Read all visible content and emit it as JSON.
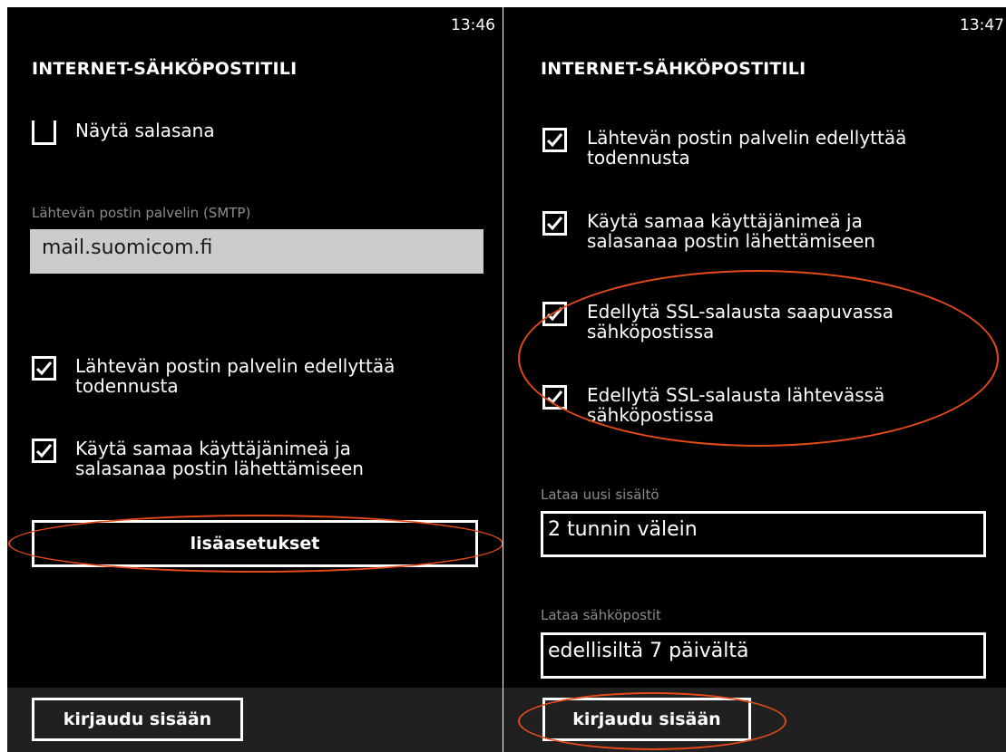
{
  "accent_colors": {
    "background": "#000000",
    "annotation": "#e64a19",
    "field_fill": "#cccccc",
    "appbar": "#202020"
  },
  "left": {
    "clock": "13:46",
    "title": "INTERNET-SÄHKÖPOSTITILI",
    "show_password": {
      "label": "Näytä salasana",
      "checked": false
    },
    "smtp": {
      "label": "Lähtevän postin palvelin (SMTP)",
      "value": "mail.suomicom.fi"
    },
    "auth_required": {
      "line1": "Lähtevän postin palvelin edellyttää",
      "line2": "todennusta",
      "checked": true
    },
    "same_credentials": {
      "line1": "Käytä samaa käyttäjänimeä ja",
      "line2": "salasanaa postin lähettämiseen",
      "checked": true
    },
    "advanced_button": "lisäasetukset",
    "signin_button": "kirjaudu sisään"
  },
  "right": {
    "clock": "13:47",
    "title": "INTERNET-SÄHKÖPOSTITILI",
    "auth_required": {
      "line1": "Lähtevän postin palvelin edellyttää",
      "line2": "todennusta",
      "checked": true
    },
    "same_credentials": {
      "line1": "Käytä samaa käyttäjänimeä ja",
      "line2": "salasanaa postin lähettämiseen",
      "checked": true
    },
    "ssl_incoming": {
      "line1": "Edellytä SSL-salausta saapuvassa",
      "line2": "sähköpostissa",
      "checked": true
    },
    "ssl_outgoing": {
      "line1": "Edellytä SSL-salausta lähtevässä",
      "line2": "sähköpostissa",
      "checked": true
    },
    "download_new": {
      "label": "Lataa uusi sisältö",
      "value": "2 tunnin välein"
    },
    "download_emails": {
      "label": "Lataa sähköpostit",
      "value": "edellisiltä 7 päivältä"
    },
    "signin_button": "kirjaudu sisään"
  }
}
